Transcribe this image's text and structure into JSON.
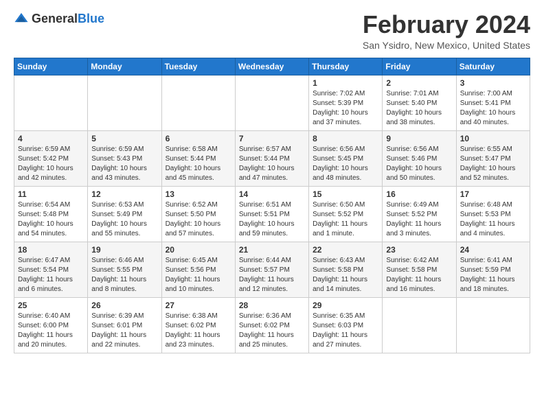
{
  "header": {
    "logo": {
      "text_general": "General",
      "text_blue": "Blue"
    },
    "title": "February 2024",
    "subtitle": "San Ysidro, New Mexico, United States"
  },
  "weekdays": [
    "Sunday",
    "Monday",
    "Tuesday",
    "Wednesday",
    "Thursday",
    "Friday",
    "Saturday"
  ],
  "weeks": [
    [
      {
        "day": "",
        "info": ""
      },
      {
        "day": "",
        "info": ""
      },
      {
        "day": "",
        "info": ""
      },
      {
        "day": "",
        "info": ""
      },
      {
        "day": "1",
        "info": "Sunrise: 7:02 AM\nSunset: 5:39 PM\nDaylight: 10 hours\nand 37 minutes."
      },
      {
        "day": "2",
        "info": "Sunrise: 7:01 AM\nSunset: 5:40 PM\nDaylight: 10 hours\nand 38 minutes."
      },
      {
        "day": "3",
        "info": "Sunrise: 7:00 AM\nSunset: 5:41 PM\nDaylight: 10 hours\nand 40 minutes."
      }
    ],
    [
      {
        "day": "4",
        "info": "Sunrise: 6:59 AM\nSunset: 5:42 PM\nDaylight: 10 hours\nand 42 minutes."
      },
      {
        "day": "5",
        "info": "Sunrise: 6:59 AM\nSunset: 5:43 PM\nDaylight: 10 hours\nand 43 minutes."
      },
      {
        "day": "6",
        "info": "Sunrise: 6:58 AM\nSunset: 5:44 PM\nDaylight: 10 hours\nand 45 minutes."
      },
      {
        "day": "7",
        "info": "Sunrise: 6:57 AM\nSunset: 5:44 PM\nDaylight: 10 hours\nand 47 minutes."
      },
      {
        "day": "8",
        "info": "Sunrise: 6:56 AM\nSunset: 5:45 PM\nDaylight: 10 hours\nand 48 minutes."
      },
      {
        "day": "9",
        "info": "Sunrise: 6:56 AM\nSunset: 5:46 PM\nDaylight: 10 hours\nand 50 minutes."
      },
      {
        "day": "10",
        "info": "Sunrise: 6:55 AM\nSunset: 5:47 PM\nDaylight: 10 hours\nand 52 minutes."
      }
    ],
    [
      {
        "day": "11",
        "info": "Sunrise: 6:54 AM\nSunset: 5:48 PM\nDaylight: 10 hours\nand 54 minutes."
      },
      {
        "day": "12",
        "info": "Sunrise: 6:53 AM\nSunset: 5:49 PM\nDaylight: 10 hours\nand 55 minutes."
      },
      {
        "day": "13",
        "info": "Sunrise: 6:52 AM\nSunset: 5:50 PM\nDaylight: 10 hours\nand 57 minutes."
      },
      {
        "day": "14",
        "info": "Sunrise: 6:51 AM\nSunset: 5:51 PM\nDaylight: 10 hours\nand 59 minutes."
      },
      {
        "day": "15",
        "info": "Sunrise: 6:50 AM\nSunset: 5:52 PM\nDaylight: 11 hours\nand 1 minute."
      },
      {
        "day": "16",
        "info": "Sunrise: 6:49 AM\nSunset: 5:52 PM\nDaylight: 11 hours\nand 3 minutes."
      },
      {
        "day": "17",
        "info": "Sunrise: 6:48 AM\nSunset: 5:53 PM\nDaylight: 11 hours\nand 4 minutes."
      }
    ],
    [
      {
        "day": "18",
        "info": "Sunrise: 6:47 AM\nSunset: 5:54 PM\nDaylight: 11 hours\nand 6 minutes."
      },
      {
        "day": "19",
        "info": "Sunrise: 6:46 AM\nSunset: 5:55 PM\nDaylight: 11 hours\nand 8 minutes."
      },
      {
        "day": "20",
        "info": "Sunrise: 6:45 AM\nSunset: 5:56 PM\nDaylight: 11 hours\nand 10 minutes."
      },
      {
        "day": "21",
        "info": "Sunrise: 6:44 AM\nSunset: 5:57 PM\nDaylight: 11 hours\nand 12 minutes."
      },
      {
        "day": "22",
        "info": "Sunrise: 6:43 AM\nSunset: 5:58 PM\nDaylight: 11 hours\nand 14 minutes."
      },
      {
        "day": "23",
        "info": "Sunrise: 6:42 AM\nSunset: 5:58 PM\nDaylight: 11 hours\nand 16 minutes."
      },
      {
        "day": "24",
        "info": "Sunrise: 6:41 AM\nSunset: 5:59 PM\nDaylight: 11 hours\nand 18 minutes."
      }
    ],
    [
      {
        "day": "25",
        "info": "Sunrise: 6:40 AM\nSunset: 6:00 PM\nDaylight: 11 hours\nand 20 minutes."
      },
      {
        "day": "26",
        "info": "Sunrise: 6:39 AM\nSunset: 6:01 PM\nDaylight: 11 hours\nand 22 minutes."
      },
      {
        "day": "27",
        "info": "Sunrise: 6:38 AM\nSunset: 6:02 PM\nDaylight: 11 hours\nand 23 minutes."
      },
      {
        "day": "28",
        "info": "Sunrise: 6:36 AM\nSunset: 6:02 PM\nDaylight: 11 hours\nand 25 minutes."
      },
      {
        "day": "29",
        "info": "Sunrise: 6:35 AM\nSunset: 6:03 PM\nDaylight: 11 hours\nand 27 minutes."
      },
      {
        "day": "",
        "info": ""
      },
      {
        "day": "",
        "info": ""
      }
    ]
  ]
}
